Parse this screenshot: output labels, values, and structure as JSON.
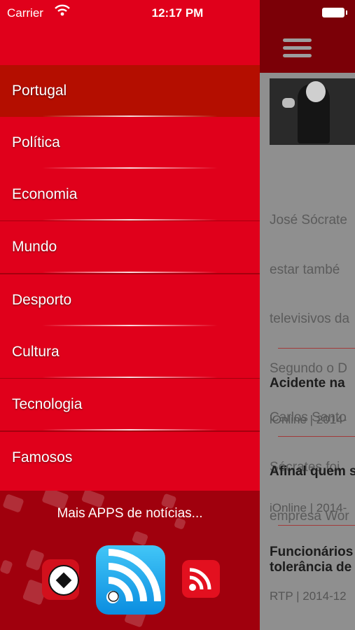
{
  "status_bar": {
    "carrier": "Carrier",
    "time": "12:17 PM"
  },
  "menu": {
    "items": [
      {
        "label": "Portugal",
        "selected": true
      },
      {
        "label": "Política",
        "selected": false
      },
      {
        "label": "Economia",
        "selected": false
      },
      {
        "label": "Mundo",
        "selected": false
      },
      {
        "label": "Desporto",
        "selected": false
      },
      {
        "label": "Cultura",
        "selected": false
      },
      {
        "label": "Tecnologia",
        "selected": false
      },
      {
        "label": "Famosos",
        "selected": false
      }
    ]
  },
  "promo": {
    "label": "Mais APPS de notícias...",
    "apps": [
      "soccer-app-icon",
      "rss-news-app-icon",
      "rss-app-icon"
    ]
  },
  "article": {
    "text_lines": [
      "José Sócrate",
      "estar també",
      "televisivos da",
      "Segundo o D",
      "Carlos Santo",
      "Sócrates foi",
      "empresa Wor"
    ]
  },
  "news": [
    {
      "title": "Acidente na",
      "meta": "iOnline | 2014-"
    },
    {
      "title": "Afinal quem s",
      "meta": "iOnline | 2014-"
    },
    {
      "title": "Funcionários\ntolerância de",
      "meta": "RTP | 2014-12"
    }
  ],
  "colors": {
    "menu_red": "#e0001b",
    "selected_red": "#b40e00",
    "dark_red": "#a0000d",
    "content_gray": "#8f8f8f"
  }
}
